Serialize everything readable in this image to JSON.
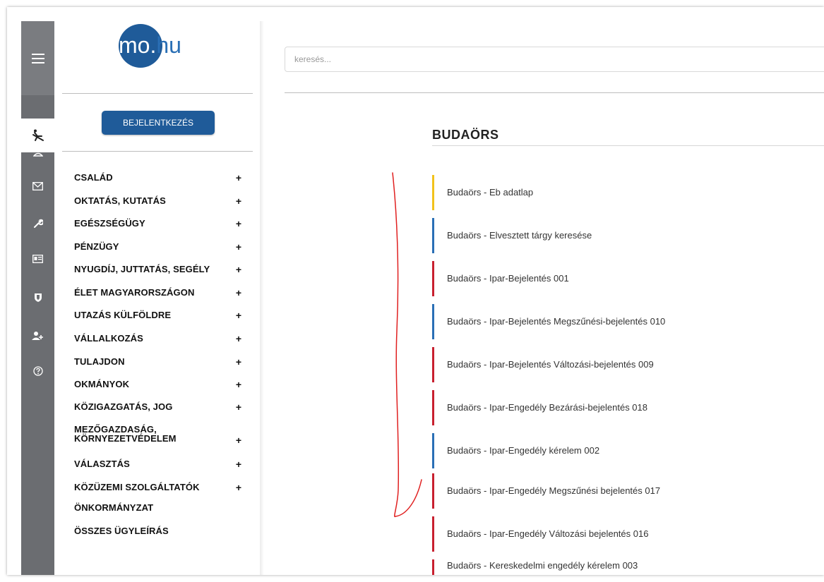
{
  "logo": {
    "mo": "mo.",
    "hu": "hu"
  },
  "sidebar": {
    "login_label": "BEJELENTKEZÉS",
    "categories": [
      {
        "label": "CSALÁD",
        "plus": "+"
      },
      {
        "label": "OKTATÁS, KUTATÁS",
        "plus": "+"
      },
      {
        "label": "EGÉSZSÉGÜGY",
        "plus": "+"
      },
      {
        "label": "PÉNZÜGY",
        "plus": "+"
      },
      {
        "label": "NYUGDÍJ, JUTTATÁS, SEGÉLY",
        "plus": "+"
      },
      {
        "label": "ÉLET MAGYARORSZÁGON",
        "plus": "+"
      },
      {
        "label": "UTAZÁS KÜLFÖLDRE",
        "plus": "+"
      },
      {
        "label": "VÁLLALKOZÁS",
        "plus": "+"
      },
      {
        "label": "TULAJDON",
        "plus": "+"
      },
      {
        "label": "OKMÁNYOK",
        "plus": "+"
      },
      {
        "label": "KÖZIGAZGATÁS, JOG",
        "plus": "+"
      },
      {
        "label": "MEZŐGAZDASÁG,",
        "label2": "KÖRNYEZETVÉDELEM",
        "plus": "+"
      },
      {
        "label": "VÁLASZTÁS",
        "plus": "+"
      },
      {
        "label": "KÖZÜZEMI SZOLGÁLTATÓK",
        "plus": "+"
      },
      {
        "label": "ÖNKORMÁNYZAT"
      },
      {
        "label": "ÖSSZES ÜGYLEÍRÁS"
      }
    ]
  },
  "search": {
    "placeholder": "keresés..."
  },
  "main": {
    "title": "BUDAÖRS",
    "items": [
      {
        "label": "Budaörs - Eb adatlap",
        "color": "#f2c21b"
      },
      {
        "label": "Budaörs - Elvesztett tárgy keresése",
        "color": "#2a6fb5"
      },
      {
        "label": "Budaörs - Ipar-Bejelentés 001",
        "color": "#c8202f"
      },
      {
        "label": "Budaörs - Ipar-Bejelentés Megszűnési-bejelentés 010",
        "color": "#2a6fb5"
      },
      {
        "label": "Budaörs - Ipar-Bejelentés Változási-bejelentés 009",
        "color": "#c8202f"
      },
      {
        "label": "Budaörs - Ipar-Engedély Bezárási-bejelentés 018",
        "color": "#c8202f"
      },
      {
        "label": "Budaörs - Ipar-Engedély kérelem 002",
        "color": "#2a6fb5"
      },
      {
        "label": "Budaörs - Ipar-Engedély Megszűnési bejelentés 017",
        "color": "#c8202f"
      },
      {
        "label": "Budaörs - Ipar-Engedély Változási bejelentés 016",
        "color": "#c8202f"
      },
      {
        "label": "Budaörs - Kereskedelmi engedély kérelem 003",
        "color": "#c8202f"
      }
    ]
  },
  "icons": [
    "menu-icon",
    "accessibility-icon",
    "user-icon",
    "mail-icon",
    "wrench-icon",
    "id-card-icon",
    "shield-icon",
    "add-user-icon",
    "help-icon"
  ]
}
